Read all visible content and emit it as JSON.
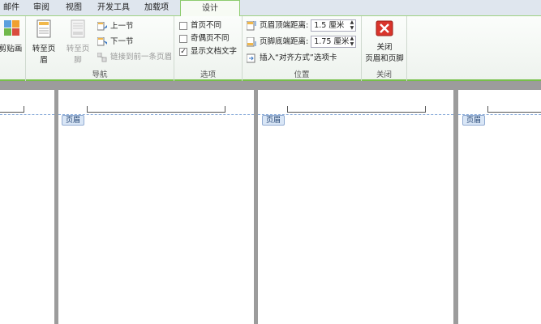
{
  "tabs": [
    "邮件",
    "审阅",
    "视图",
    "开发工具",
    "加载项",
    "设计"
  ],
  "groups": {
    "clip": {
      "label": "剪贴画"
    },
    "nav": {
      "title": "导航",
      "goto_header": "转至页眉",
      "goto_footer": "转至页脚",
      "prev": "上一节",
      "next": "下一节",
      "link_prev": "链接到前一条页眉"
    },
    "options": {
      "title": "选项",
      "diff_first": "首页不同",
      "diff_odd_even": "奇偶页不同",
      "show_text": "显示文档文字"
    },
    "position": {
      "title": "位置",
      "header_top_label": "页眉顶端距离:",
      "header_top_value": "1.5 厘米",
      "footer_bottom_label": "页脚底端距离:",
      "footer_bottom_value": "1.75 厘米",
      "insert_align": "插入“对齐方式”选项卡"
    },
    "close": {
      "title": "关闭",
      "label_line1": "关闭",
      "label_line2": "页眉和页脚"
    }
  },
  "header_tag": "页眉",
  "colors": {
    "accent": "#77c04a",
    "close_red": "#d9342b"
  }
}
